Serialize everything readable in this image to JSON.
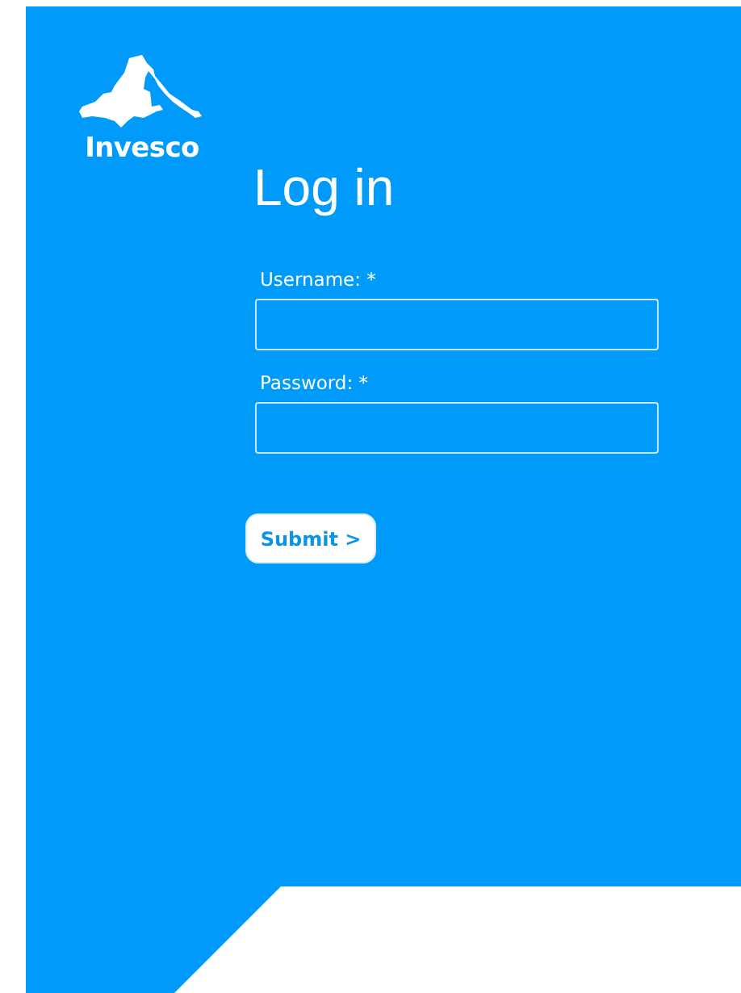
{
  "logo": {
    "text": "Invesco"
  },
  "title": "Log in",
  "fields": [
    {
      "label": "Username: *"
    },
    {
      "label": "Password: *"
    }
  ],
  "submit": "Submit >"
}
